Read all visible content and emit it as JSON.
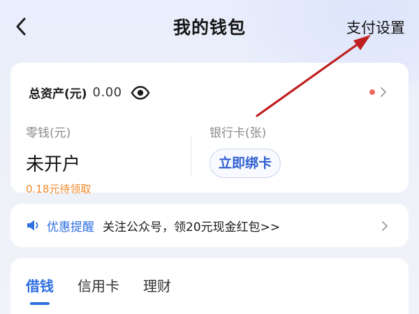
{
  "header": {
    "title": "我的钱包",
    "pay_settings": "支付设置"
  },
  "assets": {
    "total_label": "总资产(元)",
    "total_amount": "0.00",
    "change": {
      "label": "零钱(元)",
      "value": "未开户",
      "note": "0.18元待领取"
    },
    "bank": {
      "label": "银行卡(张)",
      "bind_button": "立即绑卡"
    }
  },
  "promo": {
    "tag": "优惠提醒",
    "text": "关注公众号，领20元现金红包>>"
  },
  "tabs": [
    "借钱",
    "信用卡",
    "理财"
  ],
  "colors": {
    "accent_blue": "#2f6fe0",
    "note_orange": "#f08a2a",
    "dot_red": "#f06b5f",
    "annotation_arrow": "#c0201f"
  },
  "icons": {
    "back": "back-arrow-icon",
    "eye": "eye-icon",
    "speaker": "speaker-icon",
    "chevron": "chevron-right-icon"
  }
}
